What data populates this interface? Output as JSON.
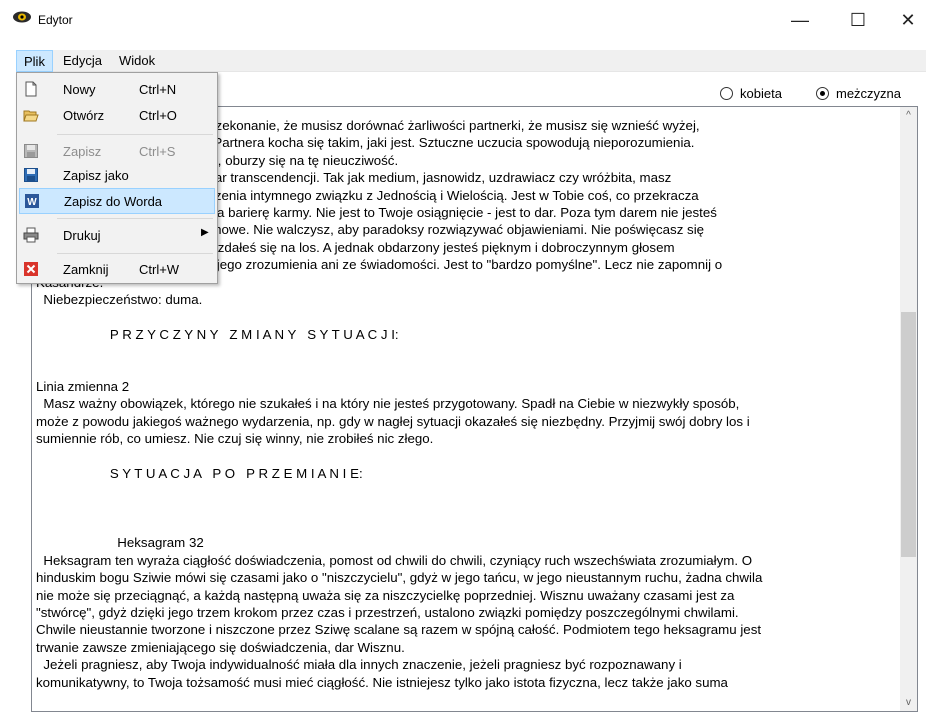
{
  "window": {
    "title": "Edytor",
    "minimize_symbol": "—",
    "maximize_symbol": "☐",
    "close_symbol": "✕"
  },
  "menubar": {
    "items": [
      {
        "label": "Plik"
      },
      {
        "label": "Edycja"
      },
      {
        "label": "Widok"
      }
    ]
  },
  "file_menu": {
    "items": [
      {
        "label": "Nowy",
        "shortcut": "Ctrl+N",
        "icon": "new-document-icon",
        "enabled": true
      },
      {
        "label": "Otwórz",
        "shortcut": "Ctrl+O",
        "icon": "open-folder-icon",
        "enabled": true
      },
      {
        "label": "Zapisz",
        "shortcut": "Ctrl+S",
        "icon": "save-disk-icon",
        "enabled": false
      },
      {
        "label": "Zapisz jako",
        "shortcut": "",
        "icon": "save-as-disk-icon",
        "enabled": true
      },
      {
        "label": "Zapisz do Worda",
        "shortcut": "",
        "icon": "word-icon",
        "enabled": true,
        "selected": true
      },
      {
        "label": "Drukuj",
        "shortcut": "",
        "icon": "printer-icon",
        "enabled": true,
        "submenu_arrow": "▶"
      },
      {
        "label": "Zamknij",
        "shortcut": "Ctrl+W",
        "icon": "close-red-icon",
        "enabled": true
      }
    ]
  },
  "gender": {
    "options": [
      {
        "label": "kobieta",
        "checked": false
      },
      {
        "label": "meżczyzna",
        "checked": true
      }
    ]
  },
  "editor": {
    "lines": [
      "                              ństwo, to przekonanie, że musisz dorównać żarliwości partnerki, że musisz się wznieść wyżej,",
      "                              uczuciami. Partnera kocha się takim, jaki jest. Sztuczne uczucia spowodują nieporozumienia.",
      "                              iebie pewna, oburzy się na tę nieucziwość.",
      "                              wrodzony dar transcendencji. Tak jak medium, jasnowidz, uzdrawiacz czy wróżbita, masz",
      "                              ość do tworzenia intymnego związku z Jednością i Wielością. Jest w Tobie coś, co przekracza",
      "                              aczając poza barierę karmy. Nie jest to Twoje osiągnięcie - jest to dar. Poza tym darem nie jesteś",
      "                              sprawy duchowe. Nie walczysz, aby paradoksy rozwiązywać objawieniami. Nie poświęcasz się",
      "                              y nawet nie zdałeś się na los. A jednak obdarzony jesteś pięknym i dobroczynnym głosem",
      "                              ącym z Twojego zrozumienia ani ze świadomości. Jest to \"bardzo pomyślne\". Lecz nie zapomnij o",
      "Kasandrze.",
      "  Niebezpieczeństwo: duma.",
      "",
      "                    P R Z Y C Z Y N Y   Z M I A N Y   S Y T U A C J I:",
      "",
      "",
      "Linia zmienna 2",
      "  Masz ważny obowiązek, którego nie szukałeś i na który nie jesteś przygotowany. Spadł na Ciebie w niezwykły sposób,",
      "może z powodu jakiegoś ważnego wydarzenia, np. gdy w nagłej sytuacji okazałeś się niezbędny. Przyjmij swój dobry los i",
      "sumiennie rób, co umiesz. Nie czuj się winny, nie zrobiłeś nic złego.",
      "",
      "                    S Y T U A C J A   P O   P R Z E M I A N I E:",
      "",
      "",
      "",
      "                      Heksagram 32",
      "  Heksagram ten wyraża ciągłość doświadczenia, pomost od chwili do chwili, czyniący ruch wszechświata zrozumiałym. O",
      "hinduskim bogu Sziwie mówi się czasami jako o \"niszczycielu\", gdyż w jego tańcu, w jego nieustannym ruchu, żadna chwila",
      "nie może się przeciągnąć, a każdą następną uważa się za niszczycielkę poprzedniej. Wisznu uważany czasami jest za",
      "\"stwórcę\", gdyż dzięki jego trzem krokom przez czas i przestrzeń, ustalono związki pomiędzy poszczególnymi chwilami.",
      "Chwile nieustannie tworzone i niszczone przez Sziwę scalane są razem w spójną całość. Podmiotem tego heksagramu jest",
      "trwanie zawsze zmieniającego się doświadczenia, dar Wisznu.",
      "  Jeżeli pragniesz, aby Twoja indywidualność miała dla innych znaczenie, jeżeli pragniesz być rozpoznawany i",
      "komunikatywny, to Twoja tożsamość musi mieć ciągłość. Nie istniejesz tylko jako istota fizyczna, lecz także jako suma"
    ]
  },
  "scrollbar": {
    "up_symbol": "^",
    "down_symbol": "v"
  }
}
